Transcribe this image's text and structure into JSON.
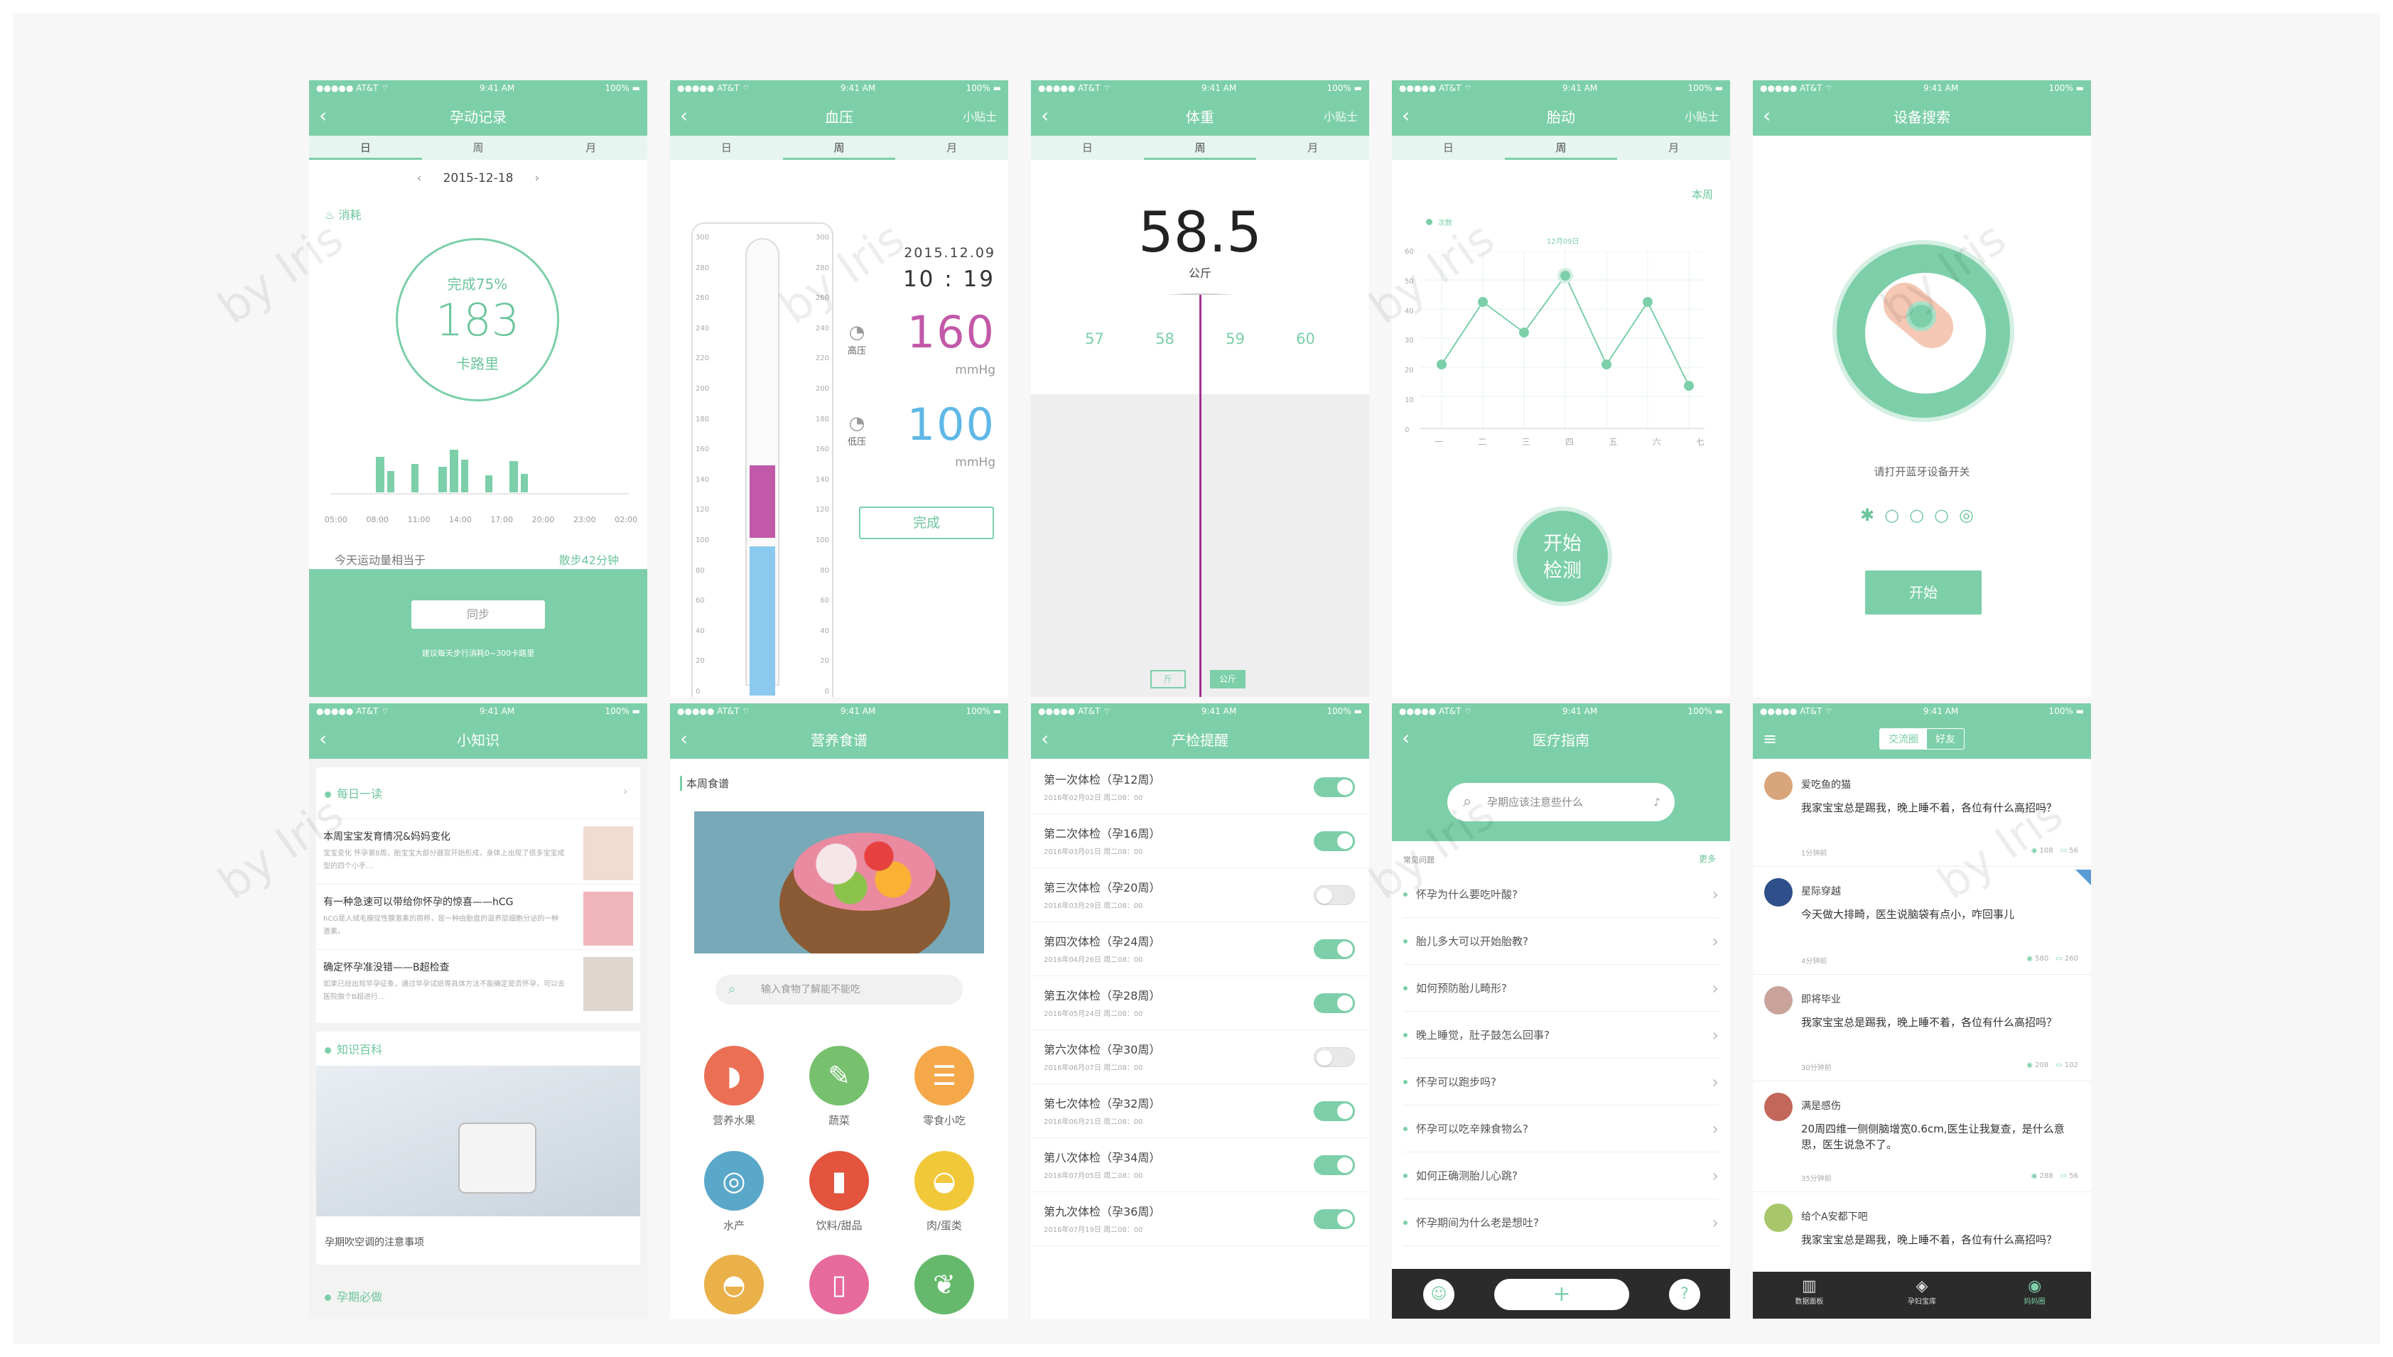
{
  "status": {
    "carrier": "●●●●● AT&T ⌔",
    "time": "9:41 AM",
    "battery": "100% ▬"
  },
  "watermark": "by Iris",
  "s1": {
    "title": "孕动记录",
    "tabs": [
      "日",
      "周",
      "月"
    ],
    "date": "2015-12-18",
    "consume": "消耗",
    "complete": "完成75%",
    "value": "183",
    "unit": "卡路里",
    "times": [
      "05:00",
      "08:00",
      "11:00",
      "14:00",
      "17:00",
      "20:00",
      "23:00",
      "02:00"
    ],
    "today": "今天运动量相当于",
    "walk": "散步42分钟",
    "sync": "同步",
    "tip": "建议每天步行消耗0~300卡路里"
  },
  "s2": {
    "title": "血压",
    "tip": "小贴士",
    "date": "2015.12.09",
    "time": "10 : 19",
    "high_label": "高压",
    "high": "160",
    "low_label": "低压",
    "low": "100",
    "unit": "mmHg",
    "done": "完成",
    "scale": [
      "300",
      "280",
      "260",
      "240",
      "220",
      "200",
      "180",
      "160",
      "140",
      "120",
      "100",
      "80",
      "60",
      "40",
      "20",
      "0"
    ]
  },
  "s3": {
    "title": "体重",
    "tip": "小贴士",
    "weight": "58.5",
    "unit": "公斤",
    "ruler": [
      "57",
      "58",
      "59",
      "60"
    ],
    "unit_jin": "斤",
    "unit_kg": "公斤"
  },
  "s4": {
    "title": "胎动",
    "tip": "小贴士",
    "week": "本周",
    "date_label": "12月09日",
    "legend": "次数",
    "yticks": [
      "60",
      "50",
      "40",
      "30",
      "20",
      "10",
      "0"
    ],
    "xticks": [
      "一",
      "二",
      "三",
      "四",
      "五",
      "六",
      "七"
    ],
    "start": "开始\n检测"
  },
  "s5": {
    "title": "设备搜索",
    "prompt": "请打开蓝牙设备开关",
    "start": "开始"
  },
  "s6": {
    "title": "小知识",
    "daily": "每日一读",
    "articles": [
      {
        "title": "本周宝宝发育情况&妈妈变化",
        "desc": "宝宝变化 怀孕第8周，胎宝宝大部分器官开始形成，身体上出现了很多宝宝成型的四个小手…"
      },
      {
        "title": "有一种急速可以带给你怀孕的惊喜——hCG",
        "desc": "hCG是人绒毛膜促性腺激素的简称，是一种由胎盘的滋养层细胞分泌的一种激素。"
      },
      {
        "title": "确定怀孕准没错——B超检查",
        "desc": "如果已经出现早孕征象，通过早孕试纸等具体方法不能确定是否怀孕，可以去医院做个B超进行…"
      }
    ],
    "encyclopedia": "知识百科",
    "ac_caption": "孕期吹空调的注意事项",
    "must": "孕期必做"
  },
  "s7": {
    "title": "营养食谱",
    "section": "本周食谱",
    "search": "输入食物了解能不能吃",
    "cats": [
      "营养水果",
      "蔬菜",
      "零食小吃",
      "水产",
      "饮料/甜品",
      "肉/蛋类"
    ]
  },
  "s8": {
    "title": "产检提醒",
    "items": [
      {
        "t": "第一次体检（孕12周）",
        "d": "2016年02月02日  周二08：00",
        "on": true
      },
      {
        "t": "第二次体检（孕16周）",
        "d": "2016年03月01日  周二08：00",
        "on": true
      },
      {
        "t": "第三次体检（孕20周）",
        "d": "2016年03月29日  周二08：00",
        "on": false
      },
      {
        "t": "第四次体检（孕24周）",
        "d": "2016年04月26日  周二08：00",
        "on": true
      },
      {
        "t": "第五次体检（孕28周）",
        "d": "2016年05月24日  周二08：00",
        "on": true
      },
      {
        "t": "第六次体检（孕30周）",
        "d": "2016年06月07日  周二08：00",
        "on": false
      },
      {
        "t": "第七次体检（孕32周）",
        "d": "2016年06月21日  周二08：00",
        "on": true
      },
      {
        "t": "第八次体检（孕34周）",
        "d": "2016年07月05日  周二08：00",
        "on": true
      },
      {
        "t": "第九次体检（孕36周）",
        "d": "2016年07月19日  周二08：00",
        "on": true
      }
    ]
  },
  "s9": {
    "title": "医疗指南",
    "search": "孕期应该注意些什么",
    "faq_label": "常见问题",
    "more": "更多",
    "faqs": [
      "怀孕为什么要吃叶酸?",
      "胎儿多大可以开始胎教?",
      "如何预防胎儿畸形?",
      "晚上睡觉，肚子鼓怎么回事?",
      "怀孕可以跑步吗?",
      "怀孕可以吃辛辣食物么?",
      "如何正确测胎儿心跳?",
      "怀孕期间为什么老是想吐?"
    ]
  },
  "s10": {
    "seg": [
      "交流圈",
      "好友"
    ],
    "posts": [
      {
        "name": "爱吃鱼的猫",
        "text": "我家宝宝总是踢我，晚上睡不着，各位有什么高招吗？",
        "time": "1分钟前",
        "views": "108",
        "comments": "56"
      },
      {
        "name": "星际穿越",
        "text": "今天做大排畸，医生说脑袋有点小，咋回事儿",
        "time": "4分钟前",
        "views": "580",
        "comments": "260"
      },
      {
        "name": "即将毕业",
        "text": "我家宝宝总是踢我，晚上睡不着，各位有什么高招吗？",
        "time": "30分钟前",
        "views": "208",
        "comments": "102"
      },
      {
        "name": "满是感伤",
        "text": "20周四维一侧侧脑增宽0.6cm,医生让我复查，是什么意思，医生说急不了。",
        "time": "35分钟前",
        "views": "288",
        "comments": "56"
      },
      {
        "name": "给个A安都下吧",
        "text": "我家宝宝总是踢我，晚上睡不着，各位有什么高招吗？",
        "time": "",
        "views": "",
        "comments": ""
      }
    ],
    "tabbar": [
      "数据面板",
      "孕妇宝库",
      "妈妈圈"
    ]
  }
}
